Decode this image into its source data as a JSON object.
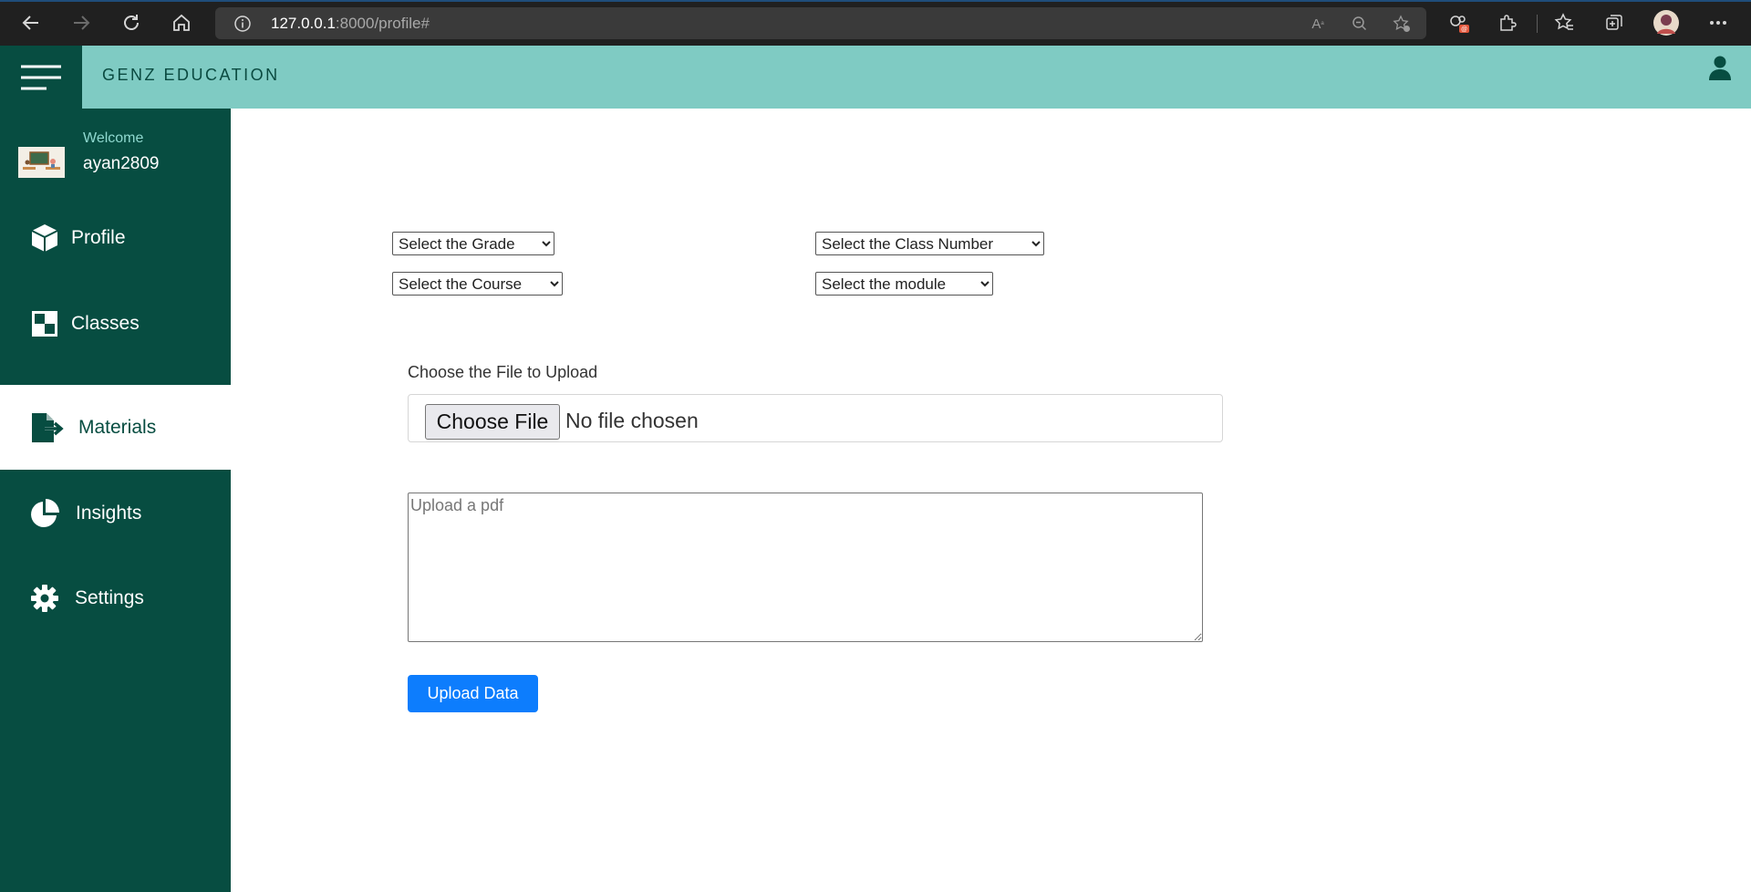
{
  "browser": {
    "url_host": "127.0.0.1",
    "url_path": ":8000/profile#"
  },
  "header": {
    "brand": "GENZ EDUCATION"
  },
  "sidebar": {
    "welcome_label": "Welcome",
    "username": "ayan2809",
    "items": [
      {
        "label": "Profile",
        "icon": "cube-icon",
        "active": false
      },
      {
        "label": "Classes",
        "icon": "grid-icon",
        "active": false
      },
      {
        "label": "Materials",
        "icon": "file-export-icon",
        "active": true
      },
      {
        "label": "Insights",
        "icon": "pie-chart-icon",
        "active": false
      },
      {
        "label": "Settings",
        "icon": "gear-icon",
        "active": false
      }
    ]
  },
  "form": {
    "grade_select": "Select the Grade",
    "class_number_select": "Select the Class Number",
    "course_select": "Select the Course",
    "module_select": "Select the module",
    "file_label": "Choose the File to Upload",
    "choose_file_button": "Choose File",
    "no_file_text": "No file chosen",
    "textarea_placeholder": "Upload a pdf",
    "upload_button": "Upload Data"
  },
  "colors": {
    "sidebar_bg": "#074d41",
    "header_bg": "#7fcbc3",
    "primary_button": "#0d7dfd"
  }
}
